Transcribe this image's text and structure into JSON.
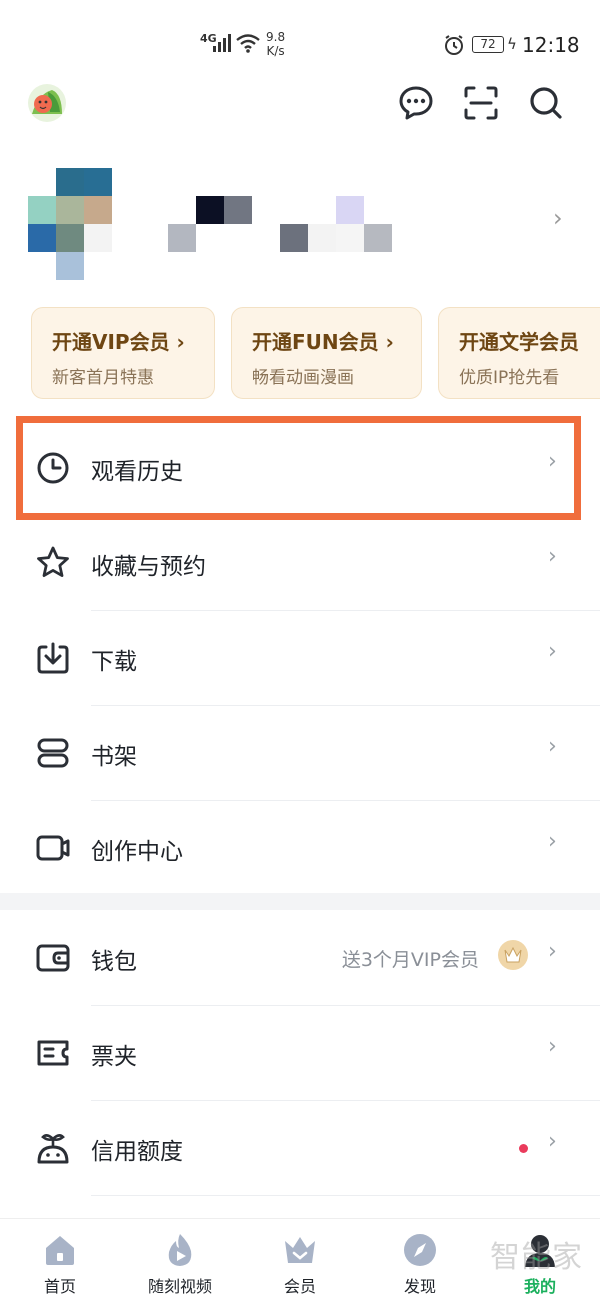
{
  "status_bar": {
    "network": "4G",
    "speed_value": "9.8",
    "speed_unit": "K/s",
    "battery": "72",
    "time": "12:18"
  },
  "header": {
    "icons": [
      "avatar",
      "message-icon",
      "scan-icon",
      "search-icon"
    ]
  },
  "vip_cards": [
    {
      "title": "开通VIP会员 ›",
      "subtitle": "新客首月特惠"
    },
    {
      "title": "开通FUN会员 ›",
      "subtitle": "畅看动画漫画"
    },
    {
      "title": "开通文学会员",
      "subtitle": "优质IP抢先看"
    }
  ],
  "menu": {
    "history": "观看历史",
    "favorites": "收藏与预约",
    "download": "下载",
    "bookshelf": "书架",
    "creation": "创作中心",
    "wallet": "钱包",
    "wallet_promo": "送3个月VIP会员",
    "tickets": "票夹",
    "credit": "信用额度",
    "chevron": "›"
  },
  "bottom_nav": {
    "home": "首页",
    "video": "随刻视频",
    "vip": "会员",
    "discover": "发现",
    "mine": "我的"
  },
  "watermark": "智能家",
  "colors": {
    "accent_green": "#1bb05d",
    "highlight_orange": "#f06d3c",
    "vip_card_bg": "#fdf4e7",
    "vip_text": "#6e4613"
  }
}
